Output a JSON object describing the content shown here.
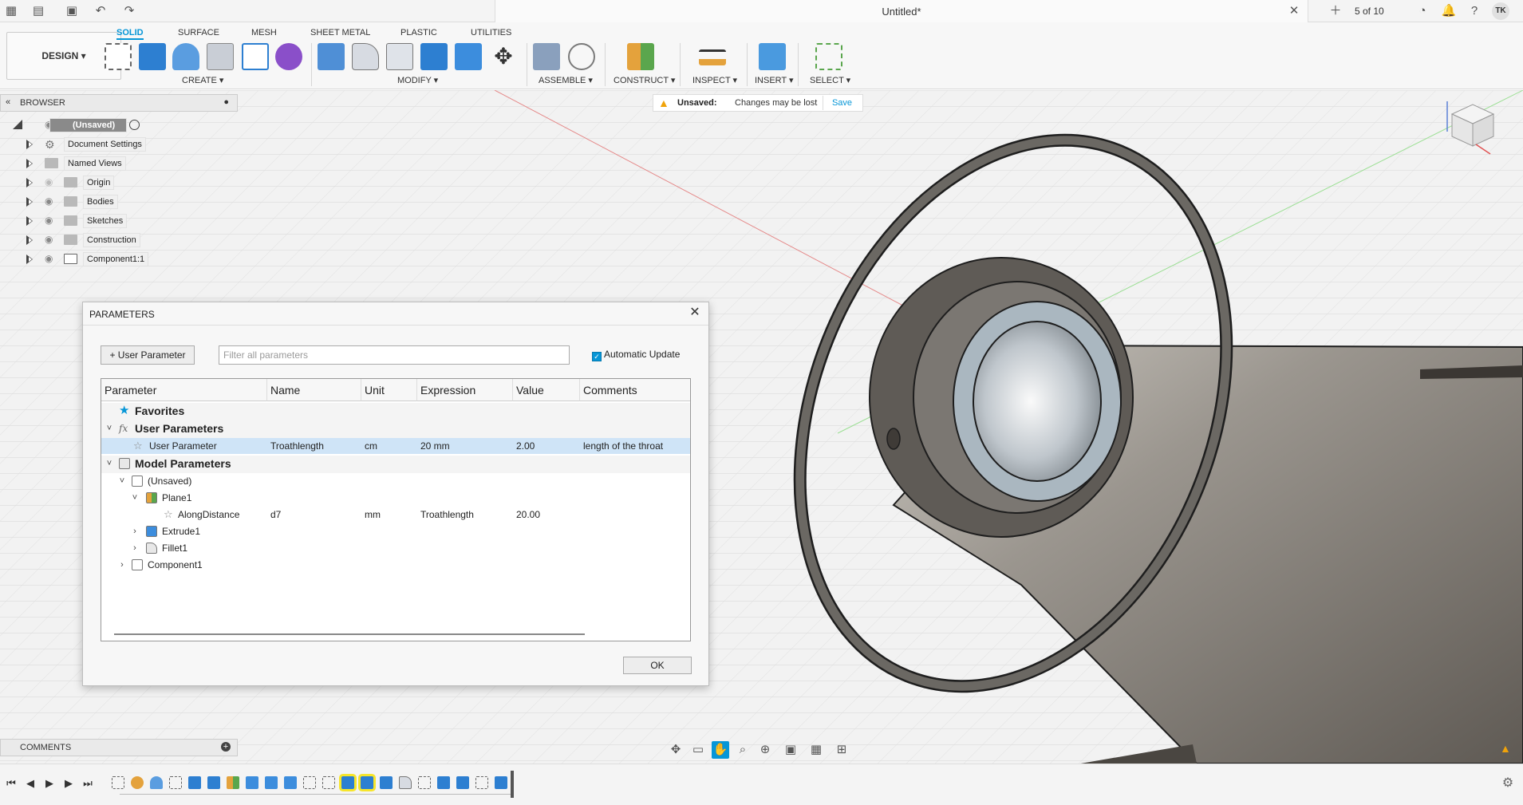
{
  "title_bar": {
    "doc_title": "Untitled*",
    "doc_count": "5 of 10",
    "user_initials": "TK"
  },
  "ribbon": {
    "workspace": "DESIGN ▾",
    "tabs": [
      "SOLID",
      "SURFACE",
      "MESH",
      "SHEET METAL",
      "PLASTIC",
      "UTILITIES"
    ],
    "active_tab": "SOLID",
    "groups": [
      "CREATE ▾",
      "MODIFY ▾",
      "ASSEMBLE ▾",
      "CONSTRUCT ▾",
      "INSPECT ▾",
      "INSERT ▾",
      "SELECT ▾"
    ]
  },
  "unsaved_banner": {
    "label": "Unsaved:",
    "message": "Changes may be lost",
    "save": "Save"
  },
  "browser": {
    "title": "BROWSER",
    "root": "(Unsaved)",
    "items": [
      "Document Settings",
      "Named Views",
      "Origin",
      "Bodies",
      "Sketches",
      "Construction",
      "Component1:1"
    ]
  },
  "parameters": {
    "title": "PARAMETERS",
    "add_button": "+ User Parameter",
    "filter_placeholder": "Filter all parameters",
    "auto_update": "Automatic Update",
    "ok": "OK",
    "columns": [
      "Parameter",
      "Name",
      "Unit",
      "Expression",
      "Value",
      "Comments"
    ],
    "groups": {
      "favorites": "Favorites",
      "user": "User Parameters",
      "model": "Model Parameters"
    },
    "user_row": {
      "parameter": "User Parameter",
      "name": "Troathlength",
      "unit": "cm",
      "expression": "20 mm",
      "value": "2.00",
      "comment": "length of the throat"
    },
    "model_tree": {
      "unsaved": "(Unsaved)",
      "plane": "Plane1",
      "along": {
        "parameter": "AlongDistance",
        "name": "d7",
        "unit": "mm",
        "expression": "Troathlength",
        "value": "20.00"
      },
      "extrude": "Extrude1",
      "fillet": "Fillet1",
      "component": "Component1"
    }
  },
  "comments": {
    "title": "COMMENTS"
  },
  "colors": {
    "accent": "#0696d7",
    "warning": "#f0a30a",
    "highlight": "#f7e52b",
    "model": "#6b6863"
  }
}
